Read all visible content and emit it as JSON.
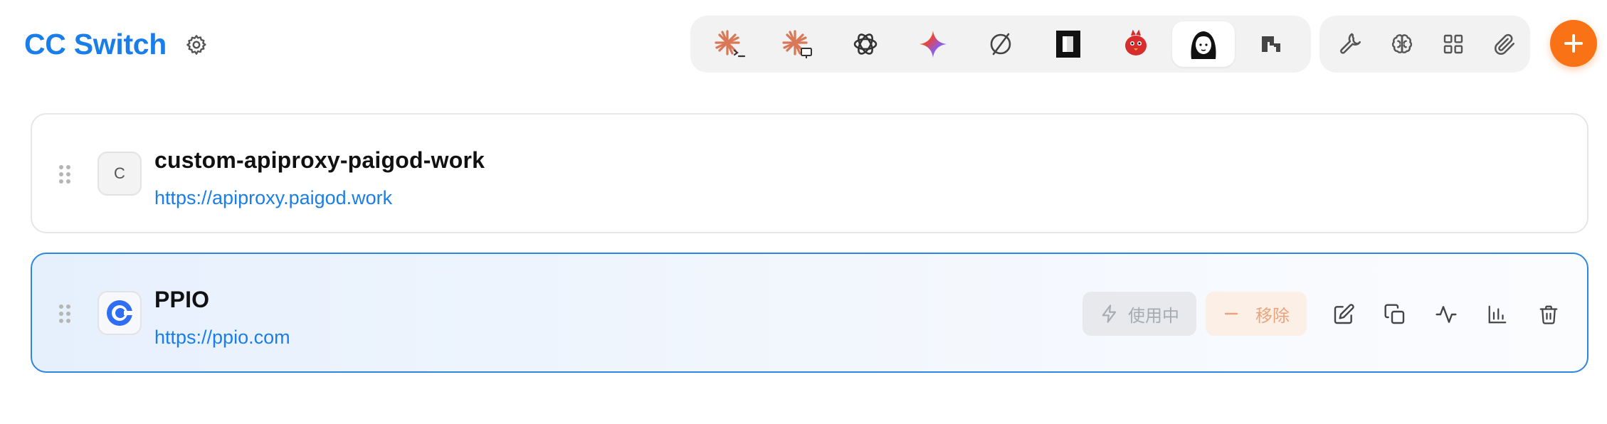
{
  "header": {
    "title": "CC Switch",
    "settings_icon": "gear-icon",
    "apps": [
      {
        "name": "claude-code",
        "icon": "claude-terminal-icon",
        "active": false
      },
      {
        "name": "claude-desktop",
        "icon": "claude-desktop-icon",
        "active": false
      },
      {
        "name": "codex",
        "icon": "openai-icon",
        "active": false
      },
      {
        "name": "gemini",
        "icon": "gemini-icon",
        "active": false
      },
      {
        "name": "opencode",
        "icon": "opencode-icon",
        "active": false
      },
      {
        "name": "cursor",
        "icon": "cursor-icon",
        "active": false
      },
      {
        "name": "droid",
        "icon": "red-bird-icon",
        "active": false
      },
      {
        "name": "character",
        "icon": "girl-avatar-icon",
        "active": true
      },
      {
        "name": "pixel",
        "icon": "pixel-logo-icon",
        "active": false
      }
    ],
    "tools": [
      "wrench-icon",
      "brain-icon",
      "grid-icon",
      "paperclip-icon"
    ],
    "add_icon": "plus-icon"
  },
  "providers": [
    {
      "avatar_letter": "C",
      "name": "custom-apiproxy-paigod-work",
      "url": "https://apiproxy.paigod.work",
      "active": false
    },
    {
      "avatar_letter": "",
      "name": "PPIO",
      "url": "https://ppio.com",
      "active": true,
      "actions": {
        "in_use_label": "使用中",
        "remove_label": "移除"
      }
    }
  ],
  "colors": {
    "accent": "#1a7ee8",
    "add_button": "#f97316",
    "selected_border": "#2b86e4"
  }
}
